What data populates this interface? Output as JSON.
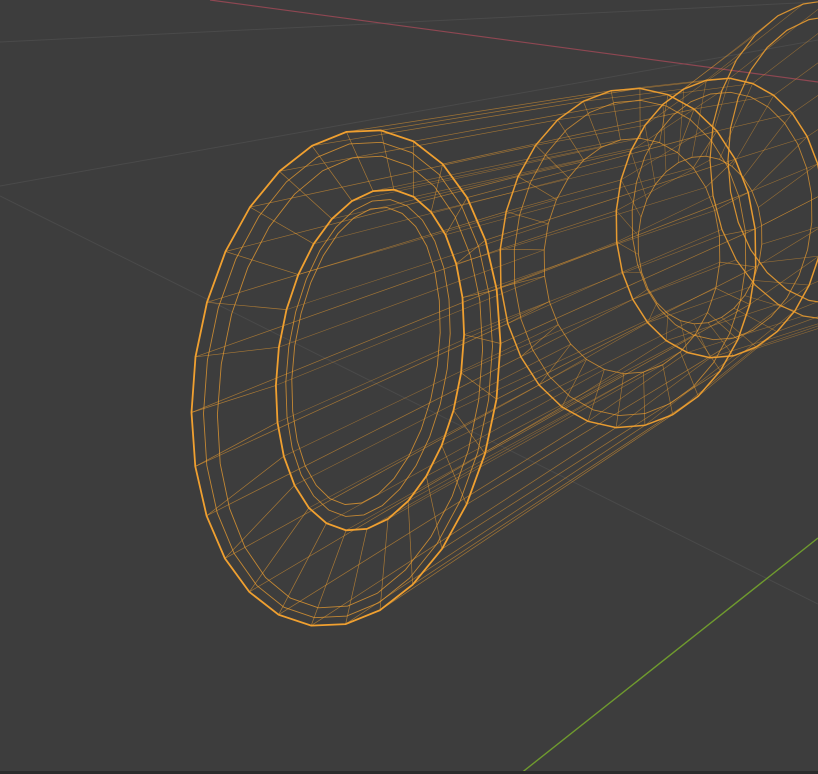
{
  "viewport": {
    "mode": "wireframe",
    "selection": "selected-object",
    "colors": {
      "background": "#3d3d3d",
      "grid_line": "#4b4b4b",
      "x_axis": "#8f4752",
      "y_axis": "#6f9a2e",
      "wire_selected": "#f0a030"
    }
  }
}
